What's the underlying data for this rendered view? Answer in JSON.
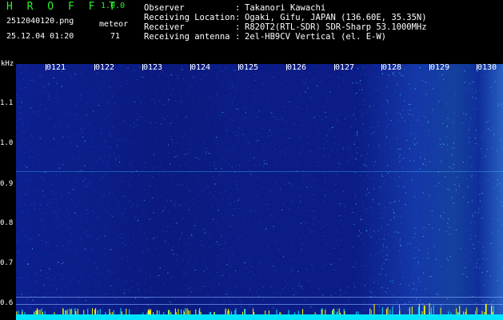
{
  "header": {
    "app_title": "H R O F F T",
    "app_version": "1.0.0",
    "file_name": "2512040120.png",
    "event_type": "meteor",
    "timestamp": "25.12.04 01:20",
    "event_count": "71"
  },
  "station": {
    "observer_label": "Observer",
    "observer_value": "Takanori Kawachi",
    "location_label": "Receiving Location",
    "location_value": "Ogaki, Gifu, JAPAN (136.60E, 35.35N)",
    "receiver_label": "Receiver",
    "receiver_value": "R820T2(RTL-SDR) SDR-Sharp 53.1000MHz",
    "antenna_label": "Receiving antenna",
    "antenna_value": "2el-HB9CV Vertical (el. E-W)",
    "separator": ":"
  },
  "spectrogram": {
    "freq_unit": "kHz",
    "freq_ticks": [
      "1.1",
      "1.0",
      "0.9",
      "0.8",
      "0.7",
      "0.6"
    ],
    "time_ticks": [
      "0121",
      "0122",
      "0123",
      "0124",
      "0125",
      "0126",
      "0127",
      "0128",
      "0129",
      "0130"
    ],
    "colors": {
      "background": "#0b1d88",
      "noise_low": "#2a4cd8",
      "noise_high": "#3ad0ff",
      "baseline": "#00e5ff",
      "spike": "#ffff00"
    }
  }
}
